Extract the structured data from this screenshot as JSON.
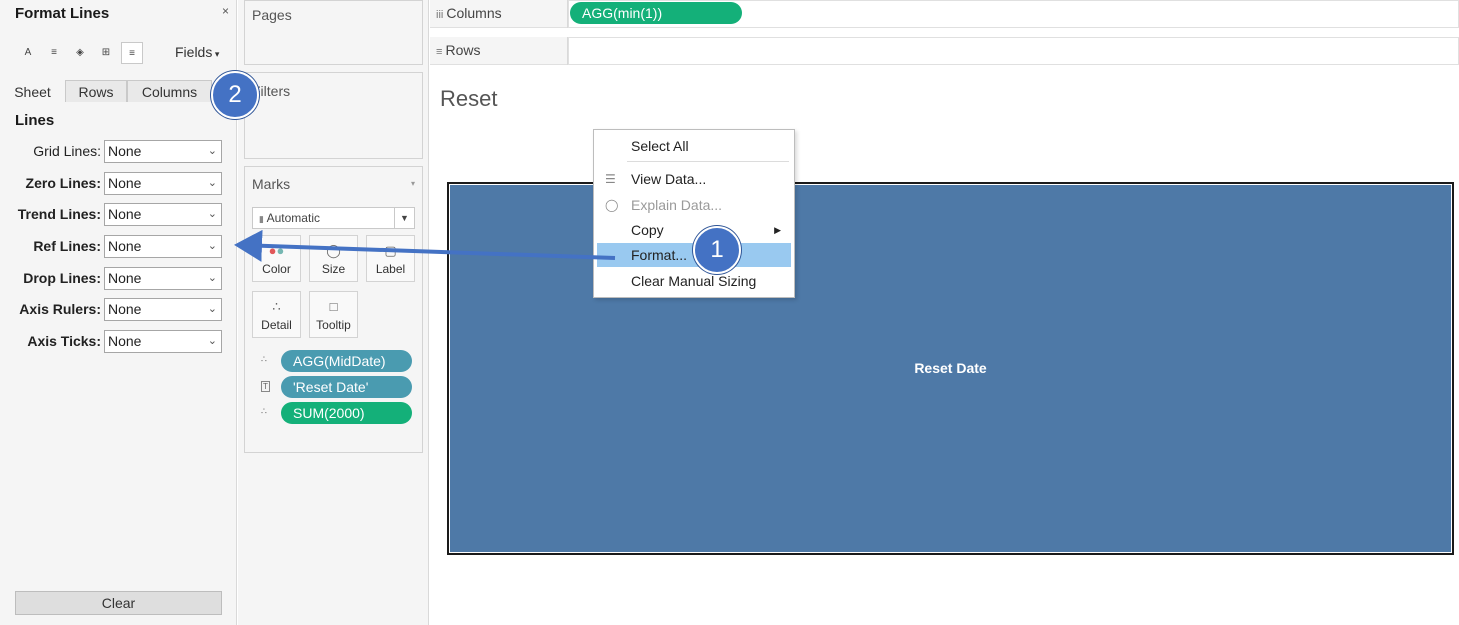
{
  "format_pane": {
    "title": "Format Lines",
    "close_glyph": "×",
    "toolbar_icons": [
      "font-icon",
      "alignment-icon",
      "shading-icon",
      "borders-icon",
      "lines-icon"
    ],
    "fields_label": "Fields",
    "tabs": [
      "Sheet",
      "Rows",
      "Columns"
    ],
    "section_title": "Lines",
    "rows": [
      {
        "label": "Grid Lines:",
        "value": "None"
      },
      {
        "label": "Zero Lines:",
        "value": "None"
      },
      {
        "label": "Trend Lines:",
        "value": "None"
      },
      {
        "label": "Ref Lines:",
        "value": "None"
      },
      {
        "label": "Drop Lines:",
        "value": "None"
      },
      {
        "label": "Axis Rulers:",
        "value": "None"
      },
      {
        "label": "Axis Ticks:",
        "value": "None"
      }
    ],
    "clear_label": "Clear"
  },
  "cards": {
    "pages_title": "Pages",
    "filters_title": "Filters",
    "marks_title": "Marks",
    "mark_type": "Automatic",
    "mark_buttons": [
      "Color",
      "Size",
      "Label",
      "Detail",
      "Tooltip"
    ],
    "pills": [
      {
        "label": "AGG(MidDate)",
        "icon": "detail-icon",
        "color": "#4a9bb0"
      },
      {
        "label": "'Reset Date'",
        "icon": "text-icon",
        "color": "#4a9bb0"
      },
      {
        "label": "SUM(2000)",
        "icon": "detail-icon",
        "color": "#14b079"
      }
    ]
  },
  "shelves": {
    "columns_label": "Columns",
    "columns_pill": "AGG(min(1))",
    "rows_label": "Rows"
  },
  "view": {
    "title": "Reset",
    "mark_label": "Reset Date",
    "mark_color": "#4e79a7"
  },
  "context_menu": {
    "items": [
      {
        "label": "Select All",
        "state": "normal"
      },
      {
        "label": "View Data...",
        "state": "normal",
        "icon": "table-icon"
      },
      {
        "label": "Explain Data...",
        "state": "disabled",
        "icon": "lightbulb-icon"
      },
      {
        "label": "Copy",
        "state": "normal",
        "submenu": true
      },
      {
        "label": "Format...",
        "state": "highlighted"
      },
      {
        "label": "Clear Manual Sizing",
        "state": "normal"
      }
    ]
  },
  "callouts": {
    "step1": "1",
    "step2": "2",
    "accent": "#4472c4"
  }
}
